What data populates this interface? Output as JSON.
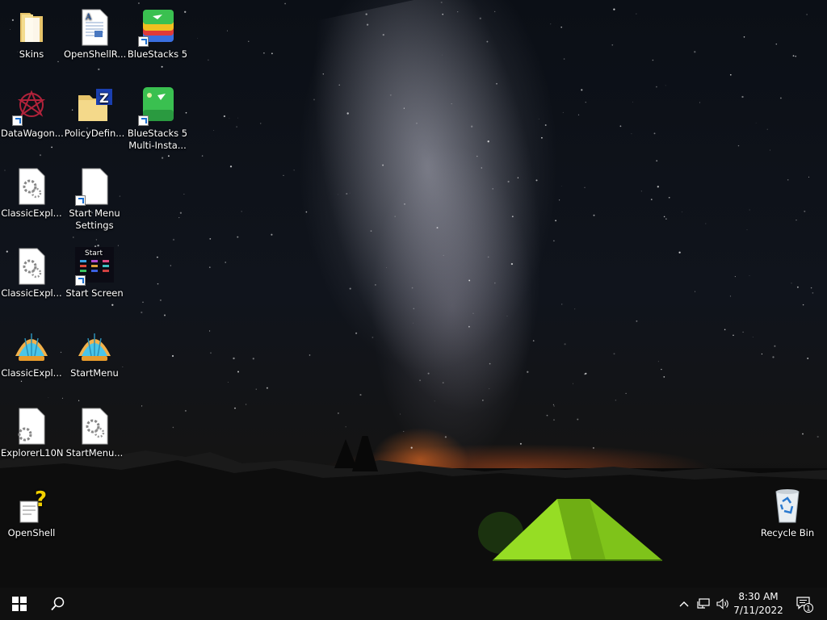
{
  "desktop": {
    "icons": [
      {
        "label": "Skins",
        "icon": "folder-icon"
      },
      {
        "label": "OpenShellR...",
        "icon": "document-icon"
      },
      {
        "label": "BlueStacks 5",
        "icon": "bluestacks-icon"
      },
      {
        "label": "DataWagon...",
        "icon": "datawagon-icon"
      },
      {
        "label": "PolicyDefin...",
        "icon": "policy-folder-icon"
      },
      {
        "label": "BlueStacks 5 Multi-Insta...",
        "icon": "bluestacks-multi-instance-icon"
      },
      {
        "label": "ClassicExpl...",
        "icon": "settings-file-icon"
      },
      {
        "label": "Start Menu Settings",
        "icon": "blank-file-icon"
      },
      {
        "label": "ClassicExpl...",
        "icon": "settings-file-icon"
      },
      {
        "label": "Start Screen",
        "icon": "start-screen-icon",
        "icon_text": "Start"
      },
      {
        "label": "ClassicExpl...",
        "icon": "shell-icon"
      },
      {
        "label": "StartMenu",
        "icon": "shell-icon"
      },
      {
        "label": "ExplorerL10N",
        "icon": "settings-file-icon"
      },
      {
        "label": "StartMenu...",
        "icon": "settings-file-icon"
      },
      {
        "label": "OpenShell",
        "icon": "help-document-icon"
      },
      {
        "label": "Recycle Bin",
        "icon": "recycle-bin-icon"
      }
    ]
  },
  "taskbar": {
    "start_icon": "windows-start-icon",
    "search_icon": "search-icon",
    "tray": {
      "chevron_icon": "chevron-up-icon",
      "network_icon": "network-icon",
      "volume_icon": "volume-icon"
    },
    "clock": {
      "time": "8:30 AM",
      "date": "7/11/2022"
    },
    "notifications": {
      "icon": "notification-icon",
      "count": "1"
    }
  },
  "colors": {
    "taskbar": "#101010",
    "tent": "#8ed11f",
    "horizon_glow": "#e2641f"
  }
}
